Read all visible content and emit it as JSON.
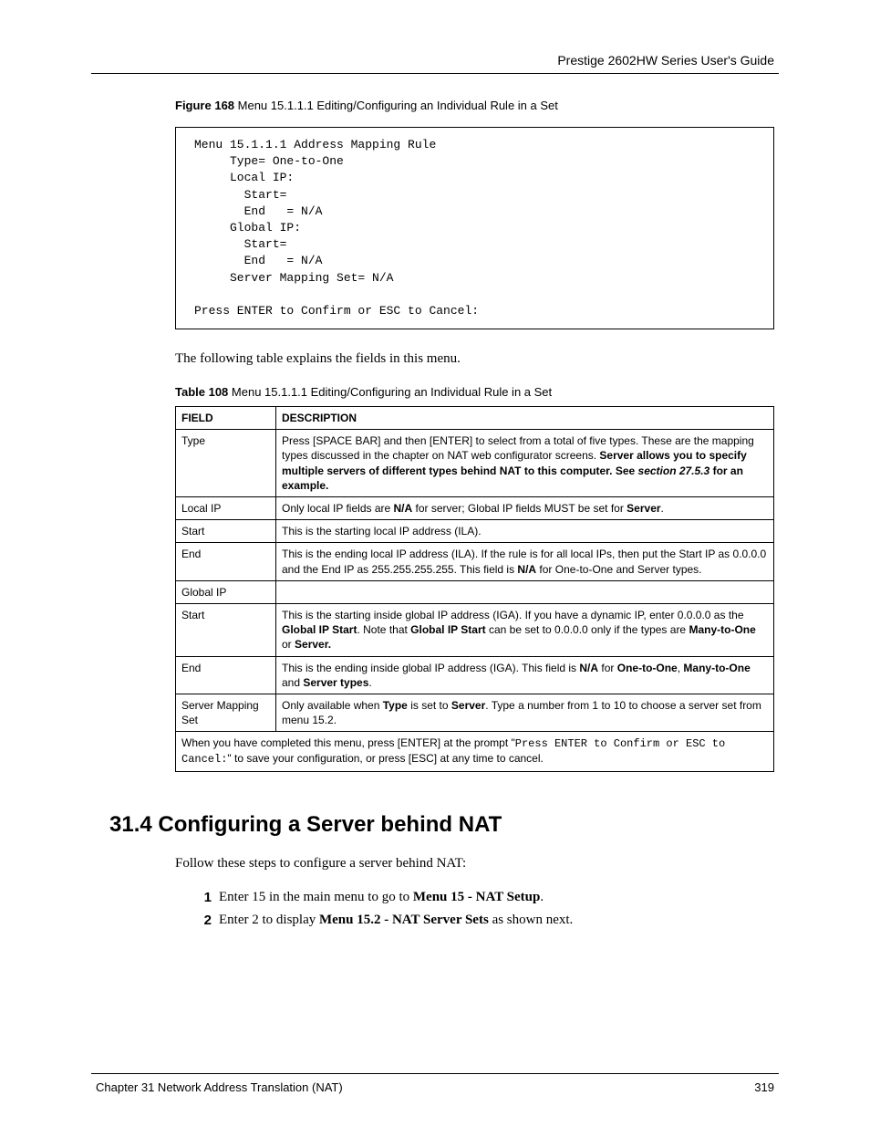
{
  "header": {
    "guide_title": "Prestige 2602HW Series User's Guide"
  },
  "figure": {
    "label_bold": "Figure 168",
    "label_rest": "   Menu 15.1.1.1 Editing/Configuring an Individual Rule in a Set",
    "menu_text": "Menu 15.1.1.1 Address Mapping Rule\n     Type= One-to-One\n     Local IP:\n       Start=\n       End   = N/A\n     Global IP:\n       Start=\n       End   = N/A\n     Server Mapping Set= N/A\n\nPress ENTER to Confirm or ESC to Cancel:"
  },
  "intro_text": "The following table explains the fields in this menu.",
  "table": {
    "label_bold": "Table 108",
    "label_rest": "   Menu 15.1.1.1 Editing/Configuring an Individual Rule in a Set",
    "headers": {
      "field": "FIELD",
      "description": "DESCRIPTION"
    },
    "rows": [
      {
        "field": "Type",
        "desc_parts": [
          {
            "t": "plain",
            "v": "Press [SPACE BAR] and then [ENTER] to select from a total of five types. These are the mapping types discussed in the chapter on NAT web configurator screens. "
          },
          {
            "t": "bold",
            "v": "Server allows you to specify multiple servers of different types behind NAT to this computer. See "
          },
          {
            "t": "bolditalic",
            "v": "section 27.5.3"
          },
          {
            "t": "bold",
            "v": " for an example."
          }
        ]
      },
      {
        "field": "Local IP",
        "desc_parts": [
          {
            "t": "plain",
            "v": "Only local IP fields are "
          },
          {
            "t": "bold",
            "v": "N/A"
          },
          {
            "t": "plain",
            "v": " for server; Global IP fields MUST be set for "
          },
          {
            "t": "bold",
            "v": "Server"
          },
          {
            "t": "plain",
            "v": "."
          }
        ]
      },
      {
        "field": "Start",
        "desc_parts": [
          {
            "t": "plain",
            "v": "This is the starting local IP address (ILA)."
          }
        ]
      },
      {
        "field": "End",
        "desc_parts": [
          {
            "t": "plain",
            "v": "This is the ending local IP address (ILA). If the rule is for all local IPs, then put the Start IP as 0.0.0.0 and the End IP as 255.255.255.255. This field is "
          },
          {
            "t": "bold",
            "v": "N/A"
          },
          {
            "t": "plain",
            "v": " for One-to-One and Server types."
          }
        ]
      },
      {
        "field": "Global IP",
        "desc_parts": []
      },
      {
        "field": "Start",
        "desc_parts": [
          {
            "t": "plain",
            "v": "This is the starting inside global IP address (IGA). If you have a dynamic IP, enter 0.0.0.0 as the "
          },
          {
            "t": "bold",
            "v": "Global IP Start"
          },
          {
            "t": "plain",
            "v": ". Note that "
          },
          {
            "t": "bold",
            "v": "Global IP Start"
          },
          {
            "t": "plain",
            "v": " can be set to 0.0.0.0 only if the types are "
          },
          {
            "t": "bold",
            "v": "Many-to-One"
          },
          {
            "t": "plain",
            "v": " or "
          },
          {
            "t": "bold",
            "v": "Server."
          }
        ]
      },
      {
        "field": "End",
        "desc_parts": [
          {
            "t": "plain",
            "v": "This is the ending inside global IP address (IGA). This field is "
          },
          {
            "t": "bold",
            "v": "N/A"
          },
          {
            "t": "plain",
            "v": " for "
          },
          {
            "t": "bold",
            "v": "One-to-One"
          },
          {
            "t": "plain",
            "v": ", "
          },
          {
            "t": "bold",
            "v": "Many-to-One"
          },
          {
            "t": "plain",
            "v": " and "
          },
          {
            "t": "bold",
            "v": "Server types"
          },
          {
            "t": "plain",
            "v": "."
          }
        ]
      },
      {
        "field": "Server Mapping Set",
        "desc_parts": [
          {
            "t": "plain",
            "v": "Only available when "
          },
          {
            "t": "bold",
            "v": "Type"
          },
          {
            "t": "plain",
            "v": " is set to "
          },
          {
            "t": "bold",
            "v": "Server"
          },
          {
            "t": "plain",
            "v": ". Type a number from 1 to 10 to choose a server set from menu 15.2."
          }
        ]
      }
    ],
    "footer_parts": [
      {
        "t": "plain",
        "v": "When you have completed this menu, press [ENTER] at the prompt \""
      },
      {
        "t": "mono",
        "v": "Press ENTER to Confirm or ESC to Cancel:"
      },
      {
        "t": "plain",
        "v": "\" to save your configuration, or press [ESC] at any time to cancel."
      }
    ]
  },
  "section": {
    "heading": "31.4  Configuring a Server behind NAT",
    "intro": "Follow these steps to configure a server behind NAT:",
    "steps": [
      {
        "num": "1",
        "parts": [
          {
            "t": "plain",
            "v": "Enter 15 in the main menu to go to "
          },
          {
            "t": "bold",
            "v": "Menu 15 - NAT Setup"
          },
          {
            "t": "plain",
            "v": "."
          }
        ]
      },
      {
        "num": "2",
        "parts": [
          {
            "t": "plain",
            "v": "Enter 2 to display "
          },
          {
            "t": "bold",
            "v": "Menu 15.2 - NAT Server Sets"
          },
          {
            "t": "plain",
            "v": " as shown next."
          }
        ]
      }
    ]
  },
  "footer": {
    "chapter": "Chapter 31 Network Address Translation (NAT)",
    "page": "319"
  }
}
